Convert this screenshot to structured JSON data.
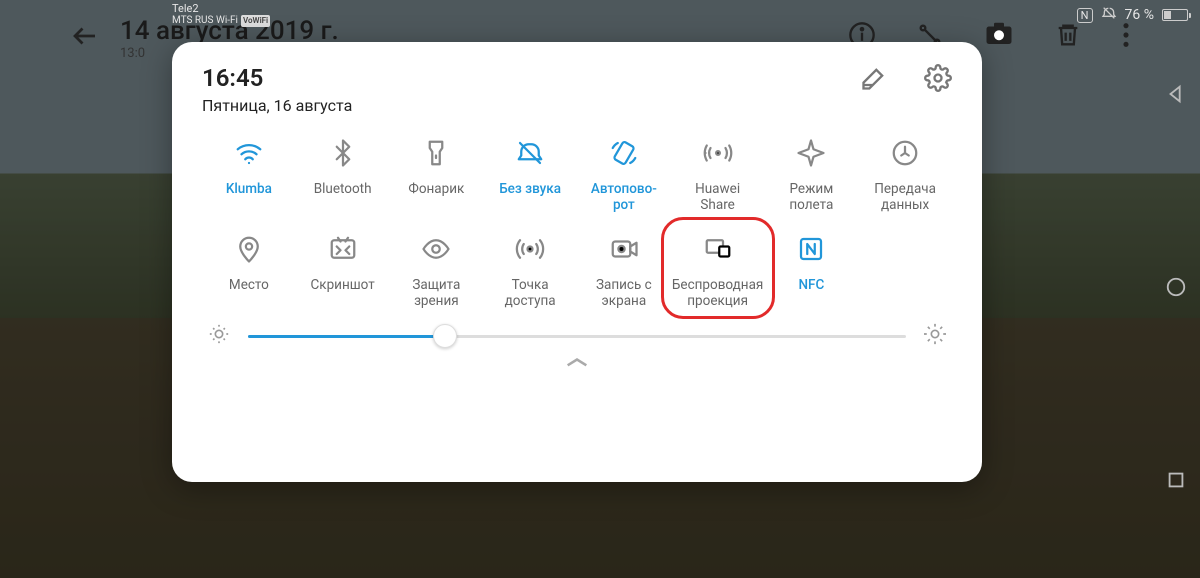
{
  "statusbar": {
    "carrier1": "Tele2",
    "carrier2": "MTS RUS Wi-Fi",
    "vowifi": "VoWiFi",
    "nfc": "N",
    "battery_pct": "76 %"
  },
  "gallery": {
    "title": "14 августа 2019 г.",
    "subtitle": "13:0"
  },
  "panel": {
    "time": "16:45",
    "date": "Пятница, 16 августа"
  },
  "tiles": [
    {
      "id": "wifi",
      "label": "Klumba",
      "active": true
    },
    {
      "id": "bluetooth",
      "label": "Bluetooth",
      "active": false
    },
    {
      "id": "flashlight",
      "label": "Фонарик",
      "active": false
    },
    {
      "id": "mute",
      "label": "Без звука",
      "active": true
    },
    {
      "id": "autorotate",
      "label": "Автопово-\nрот",
      "active": true
    },
    {
      "id": "huaweishare",
      "label": "Huawei\nShare",
      "active": false
    },
    {
      "id": "airplane",
      "label": "Режим\nполета",
      "active": false
    },
    {
      "id": "data",
      "label": "Передача\nданных",
      "active": false
    },
    {
      "id": "location",
      "label": "Место",
      "active": false
    },
    {
      "id": "screenshot",
      "label": "Скриншот",
      "active": false
    },
    {
      "id": "eyecomfort",
      "label": "Защита\nзрения",
      "active": false
    },
    {
      "id": "hotspot",
      "label": "Точка\nдоступа",
      "active": false
    },
    {
      "id": "screenrec",
      "label": "Запись с\nэкрана",
      "active": false
    },
    {
      "id": "wirelessproj",
      "label": "Беспроводная\nпроекция",
      "active": false
    },
    {
      "id": "nfc",
      "label": "NFC",
      "active": true
    }
  ],
  "brightness": {
    "value_pct": 30
  },
  "highlight_tile_index": 13
}
